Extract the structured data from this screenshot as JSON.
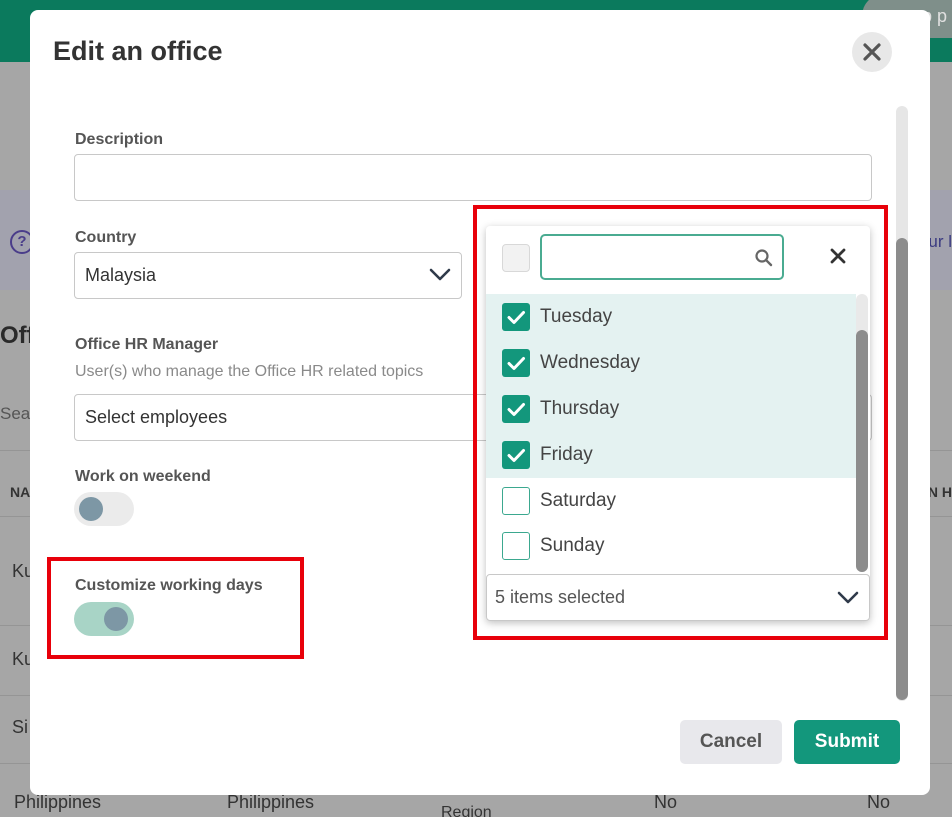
{
  "background": {
    "header_button": "p p",
    "right_link": "ur l",
    "section_title": "Off",
    "search_placeholder": "Sea",
    "table_header_left": "NA",
    "table_header_right": "N H",
    "rows": [
      "Ku",
      "Ku",
      "Si"
    ],
    "bottom_row": [
      "Philippines",
      "Philippines",
      "Region",
      "No",
      "No"
    ]
  },
  "modal": {
    "title": "Edit an office",
    "description_label": "Description",
    "description_value": "",
    "country_label": "Country",
    "country_value": "Malaysia",
    "hr_manager_label": "Office HR Manager",
    "hr_manager_helper": "User(s) who manage the Office HR related topics",
    "hr_manager_placeholder": "Select employees",
    "weekend_label": "Work on weekend",
    "weekend_on": false,
    "custom_days_label": "Customize working days",
    "custom_days_on": true,
    "cancel_label": "Cancel",
    "submit_label": "Submit"
  },
  "working_days": {
    "search_value": "",
    "items": [
      {
        "label": "Tuesday",
        "checked": true
      },
      {
        "label": "Wednesday",
        "checked": true
      },
      {
        "label": "Thursday",
        "checked": true
      },
      {
        "label": "Friday",
        "checked": true
      },
      {
        "label": "Saturday",
        "checked": false
      },
      {
        "label": "Sunday",
        "checked": false
      }
    ],
    "summary": "5 items selected"
  },
  "colors": {
    "brand_green": "#13977c",
    "highlight_red": "#e8000a",
    "selected_row": "#e4f2f1"
  }
}
